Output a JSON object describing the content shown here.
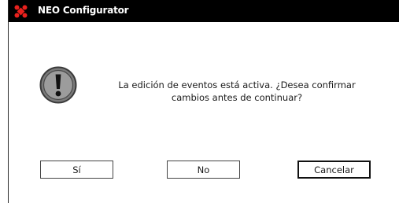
{
  "window": {
    "title": "NEO Configurator",
    "icon": "neo-logo-icon",
    "titlebar_color": "#000000",
    "logo_color": "#e8211d"
  },
  "dialog": {
    "icon": "warning-exclamation-icon",
    "message": "La edición de eventos está activa. ¿Desea confirmar\ncambios antes de continuar?"
  },
  "buttons": {
    "yes_label": "Sí",
    "no_label": "No",
    "cancel_label": "Cancelar"
  }
}
